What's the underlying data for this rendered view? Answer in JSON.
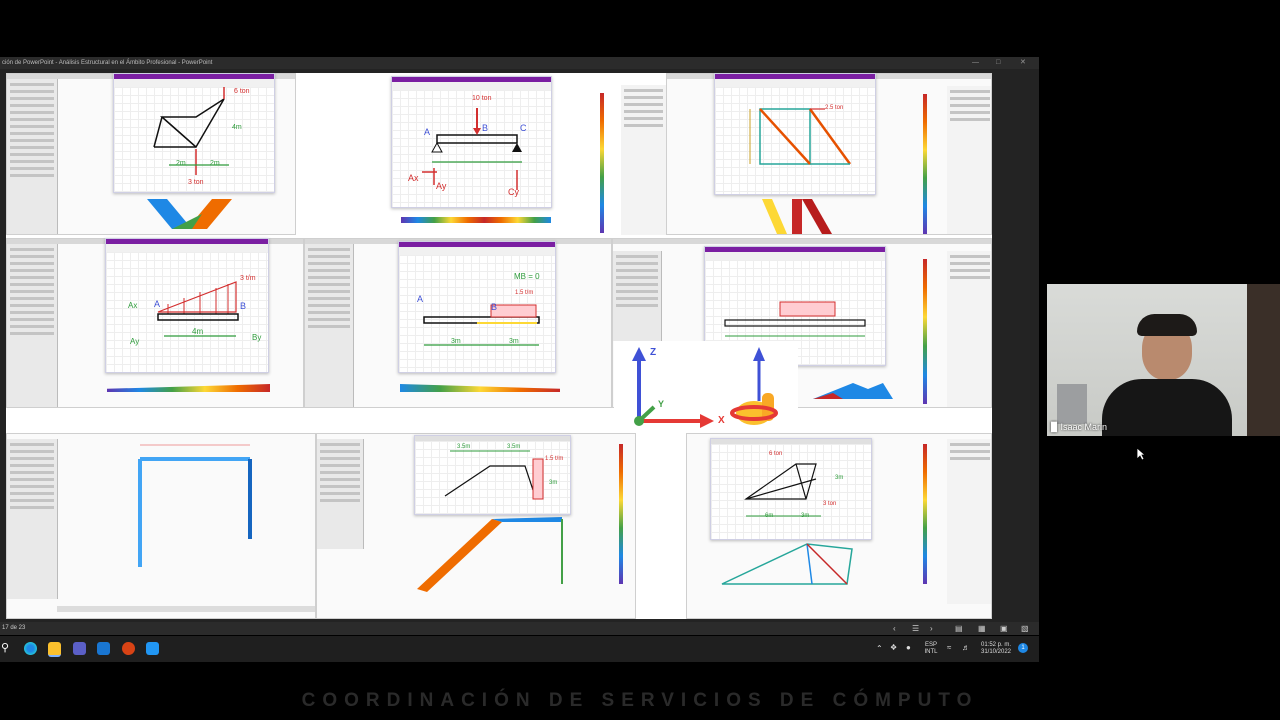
{
  "window": {
    "title": "ción de PowerPoint - Análisis Estructural en el Ámbito Profesional - PowerPoint"
  },
  "status": {
    "slide_counter": "17 de 23"
  },
  "system_tray": {
    "language": "ESP",
    "layout": "INTL",
    "time": "01:52 p. m.",
    "date": "31/10/2022"
  },
  "webcam": {
    "participant_name": "Isaac Marin"
  },
  "footer": {
    "text": "COORDINACIÓN DE SERVICIOS DE CÓMPUTO"
  },
  "diagrams": {
    "d1": {
      "load": "6 ton",
      "dim1": "4m",
      "dim2": "2m",
      "dim3": "2m",
      "force": "3 ton"
    },
    "d2": {
      "load": "10 ton",
      "a": "A",
      "b": "B",
      "c": "C",
      "ax": "Ax",
      "ay": "Ay",
      "cy": "Cy"
    },
    "d3": {
      "load": "2.5 ton"
    },
    "d4": {
      "load": "3 t/m",
      "a": "A",
      "b": "B",
      "ax": "Ax",
      "ay": "Ay",
      "by": "By",
      "span": "4m"
    },
    "d5": {
      "moment": "MB = 0",
      "load": "1.5 t/m",
      "a": "A",
      "b": "B",
      "dim1": "3m",
      "dim2": "3m"
    },
    "d6": {
      "dim1": "3.5m",
      "dim2": "3.5m",
      "load": "1.5 t/m",
      "dim3": "3m"
    },
    "d7": {
      "load": "6 ton",
      "dim1": "6m",
      "dim2": "3m",
      "dim3": "3m",
      "force": "3 ton"
    }
  },
  "axes": {
    "z": "Z",
    "y": "Y",
    "x": "X"
  },
  "colors": {
    "pen_red": "#d32f2f",
    "pen_green": "#2e9b3b",
    "accent_purple": "#7b1fa2",
    "axis_blue": "#3f51d6",
    "axis_red": "#e53935",
    "axis_green": "#43a047"
  }
}
